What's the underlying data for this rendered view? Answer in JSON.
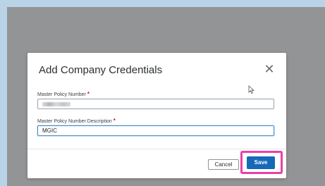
{
  "modal": {
    "title": "Add Company Credentials",
    "close_symbol": "✕"
  },
  "fields": {
    "master_policy_number": {
      "label": "Master Policy Number",
      "required_marker": "*",
      "value_redacted": true
    },
    "description": {
      "label": "Master Policy Number Description",
      "required_marker": "*",
      "value": "MGIC"
    }
  },
  "footer": {
    "cancel_label": "Cancel",
    "save_label": "Save"
  },
  "colors": {
    "save_button": "#1669b8",
    "highlight": "#ec3fa7",
    "overlay": "#939496",
    "required": "#d11a2a"
  }
}
